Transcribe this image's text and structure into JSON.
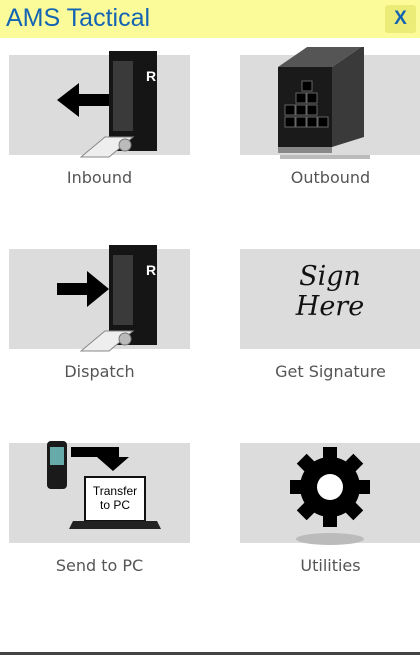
{
  "app": {
    "title": "AMS Tactical",
    "close_label": "X"
  },
  "tiles": [
    {
      "label": "Inbound",
      "icon": "truck-arrow-left-icon"
    },
    {
      "label": "Outbound",
      "icon": "loaded-trailer-icon"
    },
    {
      "label": "Dispatch",
      "icon": "truck-arrow-right-icon"
    },
    {
      "label": "Get Signature",
      "icon": "sign-here-icon",
      "sign_line1": "Sign",
      "sign_line2": "Here"
    },
    {
      "label": "Send to PC",
      "icon": "transfer-to-pc-icon",
      "screen_line1": "Transfer",
      "screen_line2": "to PC"
    },
    {
      "label": "Utilities",
      "icon": "gear-icon"
    }
  ]
}
